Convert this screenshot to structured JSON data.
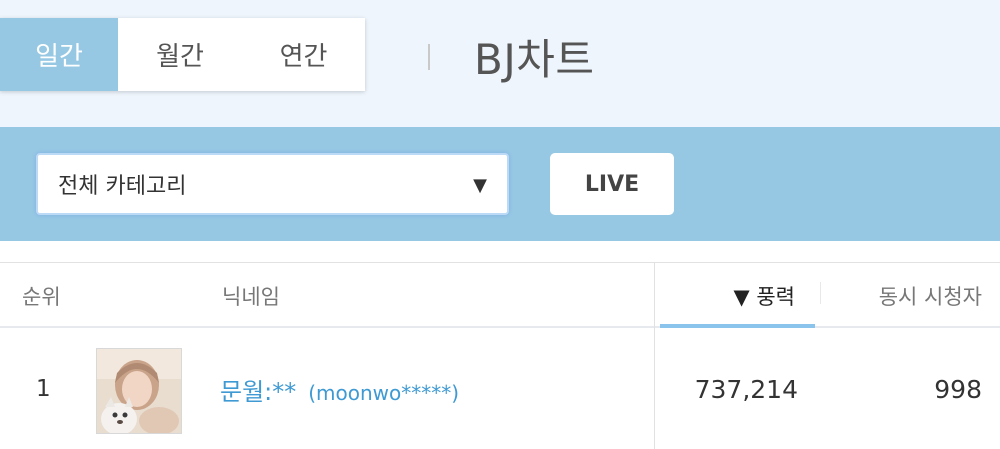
{
  "period_tabs": [
    {
      "label": "일간",
      "active": true
    },
    {
      "label": "월간",
      "active": false
    },
    {
      "label": "연간",
      "active": false
    }
  ],
  "page_title": "BJ차트",
  "filter": {
    "category_value": "전체 카테고리",
    "arrow": "▼",
    "live_label": "LIVE"
  },
  "table": {
    "headers": {
      "rank": "순위",
      "nickname": "닉네임",
      "power": "▼ 풍력",
      "viewers": "동시 시청자"
    },
    "rows": [
      {
        "rank": "1",
        "nickname": "문월:**",
        "user_id": "(moonwo*****)",
        "power": "737,214",
        "viewers": "998"
      }
    ]
  },
  "colors": {
    "accent": "#97c8e3",
    "link": "#3f9ad3",
    "top_background": "#eef5fc"
  }
}
